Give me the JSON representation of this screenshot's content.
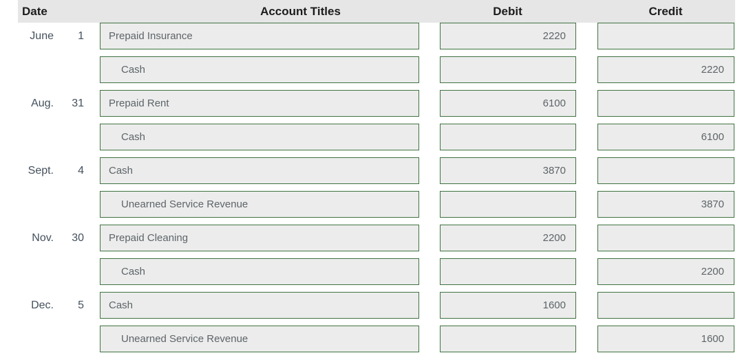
{
  "table": {
    "headers": {
      "date": "Date",
      "account_titles": "Account Titles",
      "debit": "Debit",
      "credit": "Credit"
    },
    "rows": [
      {
        "month": "June",
        "day": "1",
        "account": "Prepaid Insurance",
        "indented": false,
        "debit": "2220",
        "credit": ""
      },
      {
        "month": "",
        "day": "",
        "account": "Cash",
        "indented": true,
        "debit": "",
        "credit": "2220"
      },
      {
        "month": "Aug.",
        "day": "31",
        "account": "Prepaid Rent",
        "indented": false,
        "debit": "6100",
        "credit": ""
      },
      {
        "month": "",
        "day": "",
        "account": "Cash",
        "indented": true,
        "debit": "",
        "credit": "6100"
      },
      {
        "month": "Sept.",
        "day": "4",
        "account": "Cash",
        "indented": false,
        "debit": "3870",
        "credit": ""
      },
      {
        "month": "",
        "day": "",
        "account": "Unearned Service Revenue",
        "indented": true,
        "debit": "",
        "credit": "3870"
      },
      {
        "month": "Nov.",
        "day": "30",
        "account": "Prepaid Cleaning",
        "indented": false,
        "debit": "2200",
        "credit": ""
      },
      {
        "month": "",
        "day": "",
        "account": "Cash",
        "indented": true,
        "debit": "",
        "credit": "2200"
      },
      {
        "month": "Dec.",
        "day": "5",
        "account": "Cash",
        "indented": false,
        "debit": "1600",
        "credit": ""
      },
      {
        "month": "",
        "day": "",
        "account": "Unearned Service Revenue",
        "indented": true,
        "debit": "",
        "credit": "1600"
      }
    ]
  },
  "colors": {
    "header_background": "#e6e6e6",
    "field_background": "#ececec",
    "field_border": "#3f7240",
    "field_text": "#5d6468",
    "date_text": "#44505c",
    "header_text": "#1c1c1c"
  }
}
